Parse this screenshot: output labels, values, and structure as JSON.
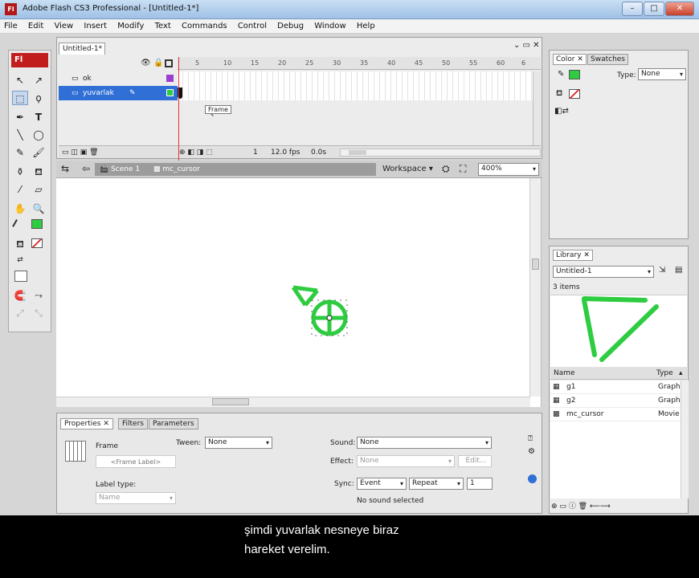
{
  "window": {
    "app_icon": "Fl",
    "title": "Adobe Flash CS3 Professional - [Untitled-1*]",
    "min_btn": "–",
    "max_btn": "□",
    "close_btn": "✕"
  },
  "menu": [
    "File",
    "Edit",
    "View",
    "Insert",
    "Modify",
    "Text",
    "Commands",
    "Control",
    "Debug",
    "Window",
    "Help"
  ],
  "tools": {
    "logo": "Fl",
    "text_tool": "T"
  },
  "timeline": {
    "doc_tab": "Untitled-1*",
    "ruler_ticks": [
      "5",
      "10",
      "15",
      "20",
      "25",
      "30",
      "35",
      "40",
      "45",
      "50",
      "55",
      "60",
      "6"
    ],
    "layers": [
      {
        "name": "ok",
        "color": "#9a3fd0",
        "selected": false
      },
      {
        "name": "yuvarlak",
        "color": "#2ecc40",
        "selected": true
      }
    ],
    "tooltip": "Frame",
    "frame_no": "1",
    "fps": "12.0 fps",
    "time": "0.0s"
  },
  "scene": {
    "crumb1": "Scene 1",
    "crumb2": "mc_cursor",
    "workspace": "Workspace",
    "zoom": "400%"
  },
  "properties": {
    "tabs": [
      "Properties",
      "Filters",
      "Parameters"
    ],
    "frame_label": "Frame",
    "frame_placeholder": "<Frame Label>",
    "tween_label": "Tween:",
    "tween_value": "None",
    "label_type_label": "Label type:",
    "label_type_value": "Name",
    "sound_label": "Sound:",
    "sound_value": "None",
    "effect_label": "Effect:",
    "effect_value": "None",
    "edit_btn": "Edit...",
    "sync_label": "Sync:",
    "sync_value": "Event",
    "repeat_value": "Repeat",
    "repeat_count": "1",
    "sound_status": "No sound selected"
  },
  "color_panel": {
    "tabs": [
      "Color",
      "Swatches"
    ],
    "type_label": "Type:",
    "type_value": "None",
    "fill_color": "#2ecc40"
  },
  "library": {
    "tab": "Library",
    "document": "Untitled-1",
    "count": "3 items",
    "col_name": "Name",
    "col_type": "Type",
    "items": [
      {
        "name": "g1",
        "type": "Graph"
      },
      {
        "name": "g2",
        "type": "Graph"
      },
      {
        "name": "mc_cursor",
        "type": "Movie"
      }
    ]
  },
  "subtitle": {
    "line1": "şimdi yuvarlak nesneye biraz",
    "line2": "hareket verelim."
  }
}
